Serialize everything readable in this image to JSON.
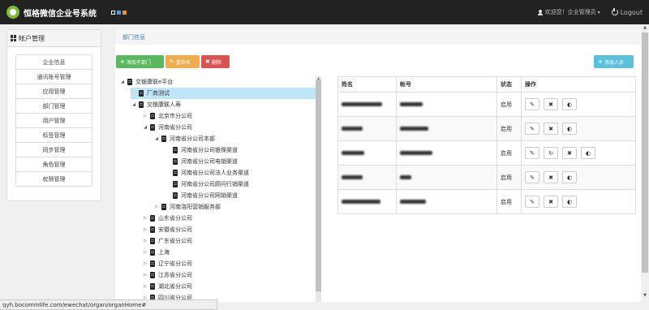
{
  "header": {
    "title": "恒格微信企业号系统",
    "user_text": "欢迎您！企业管理员",
    "logout_label": "Logout"
  },
  "sidebar": {
    "title": "帐户管理",
    "items": [
      {
        "label": "企业信息"
      },
      {
        "label": "通讯账号管理"
      },
      {
        "label": "应用管理"
      },
      {
        "label": "部门管理"
      },
      {
        "label": "用户管理"
      },
      {
        "label": "标签管理"
      },
      {
        "label": "同步管理"
      },
      {
        "label": "角色管理"
      },
      {
        "label": "权限管理"
      }
    ]
  },
  "breadcrumb": "部门信息",
  "toolbar": {
    "add_sub_label": "添加子部门",
    "rename_label": "重命名",
    "delete_label": "删除",
    "add_person_label": "添加人员"
  },
  "tree": [
    {
      "label": "交银康联e平台",
      "level": 0,
      "toggle": "expanded"
    },
    {
      "label": "厂商测试",
      "level": 1,
      "toggle": "none",
      "selected": true
    },
    {
      "label": "交银康联人寿",
      "level": 1,
      "toggle": "expanded"
    },
    {
      "label": "北京市分公司",
      "level": 2,
      "toggle": "collapsed"
    },
    {
      "label": "河南省分公司",
      "level": 2,
      "toggle": "expanded"
    },
    {
      "label": "河南省分公司本部",
      "level": 3,
      "toggle": "expanded"
    },
    {
      "label": "河南省分公司银保渠道",
      "level": 4,
      "toggle": "none"
    },
    {
      "label": "河南省分公司电销渠道",
      "level": 4,
      "toggle": "none"
    },
    {
      "label": "河南省分公司法人业务渠道",
      "level": 4,
      "toggle": "none"
    },
    {
      "label": "河南省分公司顾问行销渠道",
      "level": 4,
      "toggle": "none"
    },
    {
      "label": "河南省分公司网销渠道",
      "level": 4,
      "toggle": "none"
    },
    {
      "label": "河南洛阳营销服务部",
      "level": 3,
      "toggle": "collapsed"
    },
    {
      "label": "山东省分公司",
      "level": 2,
      "toggle": "collapsed"
    },
    {
      "label": "安徽省分公司",
      "level": 2,
      "toggle": "collapsed"
    },
    {
      "label": "广东省分公司",
      "level": 2,
      "toggle": "collapsed"
    },
    {
      "label": "上海",
      "level": 2,
      "toggle": "collapsed"
    },
    {
      "label": "辽宁省分公司",
      "level": 2,
      "toggle": "collapsed"
    },
    {
      "label": "江苏省分公司",
      "level": 2,
      "toggle": "collapsed"
    },
    {
      "label": "湖北省分公司",
      "level": 2,
      "toggle": "collapsed"
    },
    {
      "label": "四川省分公司",
      "level": 2,
      "toggle": "collapsed"
    }
  ],
  "table": {
    "columns": [
      "姓名",
      "帐号",
      "状态",
      "操作"
    ],
    "rows": [
      {
        "status": "启用",
        "has_reset": false
      },
      {
        "status": "启用",
        "has_reset": false
      },
      {
        "status": "启用",
        "has_reset": true
      },
      {
        "status": "启用",
        "has_reset": false
      },
      {
        "status": "启用",
        "has_reset": false
      }
    ]
  },
  "status_bar": "qyh.bocommlife.com/ewechat/organ/organHome#"
}
